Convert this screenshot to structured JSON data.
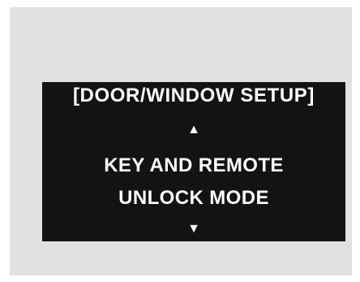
{
  "display": {
    "header": "[DOOR/WINDOW SETUP]",
    "up_arrow": "▲",
    "menu_item": {
      "line1": "KEY AND REMOTE",
      "line2": "UNLOCK MODE"
    },
    "down_arrow": "▼"
  },
  "colors": {
    "frame_background": "#e1e1e3",
    "screen_background": "#131313",
    "text": "#ffffff"
  }
}
